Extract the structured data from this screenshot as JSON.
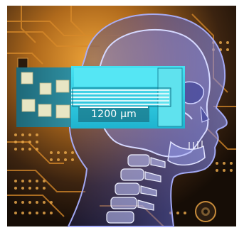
{
  "image": {
    "scale_label": "1200 μm"
  }
}
